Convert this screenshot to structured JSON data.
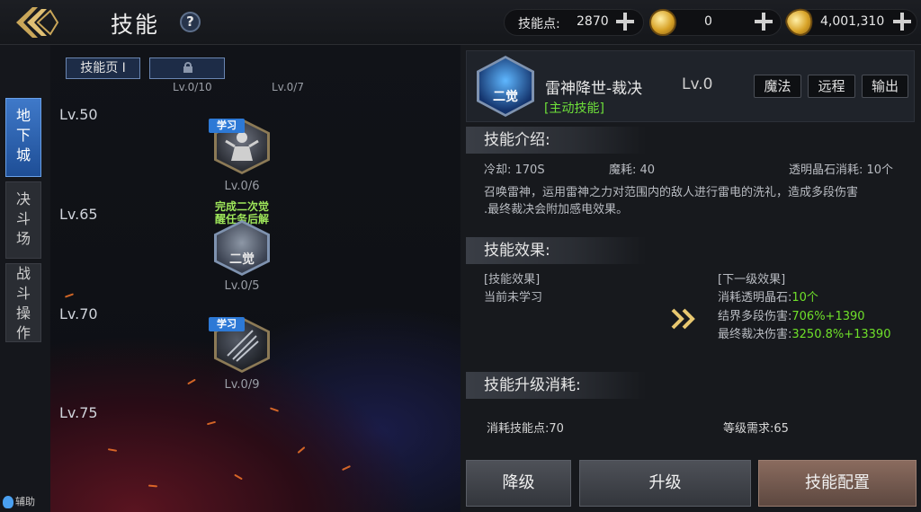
{
  "header": {
    "title": "技能",
    "help": "?",
    "currencies": [
      {
        "label": "技能点:",
        "value": "2870",
        "icon": "skill-point"
      },
      {
        "label": "",
        "value": "0",
        "icon": "gold-coin-icon"
      },
      {
        "label": "",
        "value": "4,001,310",
        "icon": "gold-coin-lock-icon"
      }
    ]
  },
  "sidebar": {
    "tabs": [
      {
        "label": [
          "地",
          "下",
          "城"
        ],
        "active": true
      },
      {
        "label": [
          "决",
          "斗",
          "场"
        ],
        "active": false
      },
      {
        "label": [
          "战",
          "斗",
          "操",
          "作"
        ],
        "active": false
      }
    ],
    "assist": "辅助"
  },
  "skill_pages": {
    "tabs": [
      {
        "label": "技能页 I"
      },
      {
        "label": "",
        "locked": true
      }
    ],
    "counts": [
      "Lv.0/10",
      "Lv.0/7"
    ]
  },
  "tree": {
    "levels": [
      "Lv.50",
      "Lv.65",
      "Lv.70",
      "Lv.75"
    ],
    "nodes": [
      {
        "badge": "学习",
        "level": "Lv.0/6"
      },
      {
        "note": "完成二次觉醒任务后解",
        "level": "Lv.0/5",
        "icon_text": "二觉"
      },
      {
        "badge": "学习",
        "level": "Lv.0/9"
      }
    ]
  },
  "detail": {
    "icon_text": "二觉",
    "name": "雷神降世-裁决",
    "level": "Lv.0",
    "type": "[主动技能]",
    "tags": [
      "魔法",
      "远程",
      "输出"
    ],
    "intro": {
      "title": "技能介绍:",
      "cooldown": "冷却: 170S",
      "mana": "魔耗: 40",
      "crystal": "透明晶石消耗: 10个",
      "desc_line1": "召唤雷神，运用雷神之力对范围内的敌人进行雷电的洗礼，造成多段伤害",
      "desc_line2": ".最终裁决会附加感电效果。"
    },
    "effect": {
      "title": "技能效果:",
      "current_title": "[技能效果]",
      "current_text": "当前未学习",
      "next_title": "[下一级效果]",
      "next_lines": [
        {
          "label": "消耗透明晶石:",
          "value": "10个"
        },
        {
          "label": "结界多段伤害:",
          "value": "706%+1390"
        },
        {
          "label": "最终裁决伤害:",
          "value": "3250.8%+13390"
        }
      ]
    },
    "upgrade": {
      "title": "技能升级消耗:",
      "skill_points": "消耗技能点:70",
      "level_req": "等级需求:65"
    }
  },
  "buttons": {
    "downgrade": "降级",
    "upgrade": "升级",
    "config": "技能配置"
  }
}
